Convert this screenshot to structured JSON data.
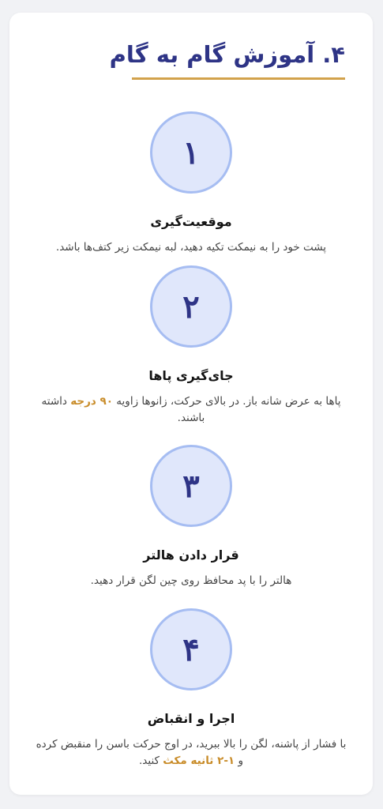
{
  "section": {
    "title": "۴. آموزش گام به گام"
  },
  "steps": [
    {
      "number": "۱",
      "title": "موقعیت‌گیری",
      "desc_before": "پشت خود را به نیمکت تکیه دهید، لبه نیمکت زیر کتف‌ها باشد.",
      "desc_highlight": "",
      "desc_after": ""
    },
    {
      "number": "۲",
      "title": "جای‌گیری پاها",
      "desc_before": "پاها به عرض شانه باز. در بالای حرکت، زانوها زاویه ",
      "desc_highlight": "۹۰ درجه",
      "desc_after": " داشته باشند."
    },
    {
      "number": "۳",
      "title": "قرار دادن هالتر",
      "desc_before": "هالتر را با پد محافظ روی چین لگن قرار دهید.",
      "desc_highlight": "",
      "desc_after": ""
    },
    {
      "number": "۴",
      "title": "اجرا و انقباض",
      "desc_before": "با فشار از پاشنه، لگن را بالا ببرید، در اوج حرکت باسن را منقبض کرده و ",
      "desc_highlight": "۱-۲ ثانیه مکث",
      "desc_after": " کنید."
    }
  ],
  "colors": {
    "title": "#2e3486",
    "accent_rule": "#d2a24c",
    "circle_fill": "#e0e7fb",
    "circle_border": "#a6bdf2",
    "highlight": "#c98d2b"
  }
}
